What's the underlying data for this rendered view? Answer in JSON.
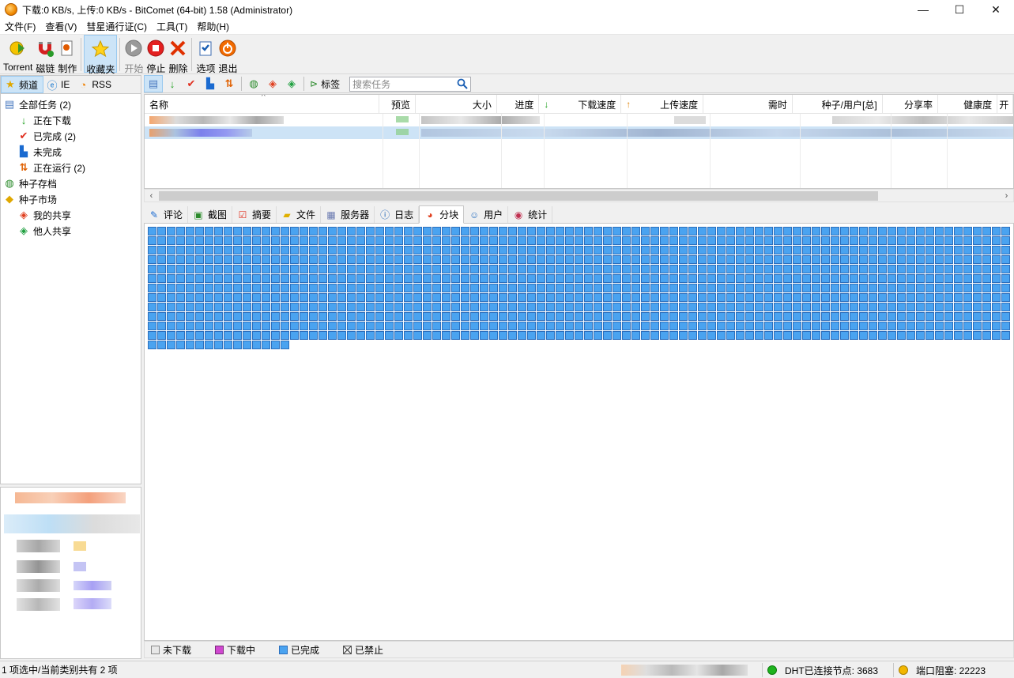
{
  "window": {
    "title": "下载:0 KB/s, 上传:0 KB/s - BitComet (64-bit) 1.58 (Administrator)",
    "minimize": "—",
    "maximize": "☐",
    "close": "✕"
  },
  "menu": [
    "文件(F)",
    "查看(V)",
    "彗星通行证(C)",
    "工具(T)",
    "帮助(H)"
  ],
  "toolbar": {
    "torrent": "Torrent",
    "magnet": "磁链",
    "make": "制作",
    "favorites": "收藏夹",
    "start": "开始",
    "stop": "停止",
    "delete": "删除",
    "options": "选项",
    "exit": "退出"
  },
  "left_tabs": {
    "channel": "频道",
    "ie": "IE",
    "rss": "RSS"
  },
  "tree": {
    "all": "全部任务 (2)",
    "downloading": "正在下载",
    "completed": "已完成 (2)",
    "incomplete": "未完成",
    "running": "正在运行 (2)",
    "archive": "种子存档",
    "market": "种子市场",
    "my_share": "我的共享",
    "others_share": "他人共享"
  },
  "task_toolbar": {
    "tag": "标签",
    "search_placeholder": "搜索任务"
  },
  "columns": {
    "name": "名称",
    "preview": "预览",
    "size": "大小",
    "progress": "进度",
    "down_speed": "下载速度",
    "up_speed": "上传速度",
    "eta": "需时",
    "seeds": "种子/用户[总]",
    "ratio": "分享率",
    "health": "健康度",
    "more": "开"
  },
  "detail_tabs": {
    "comment": "评论",
    "screenshot": "截图",
    "summary": "摘要",
    "files": "文件",
    "trackers": "服务器",
    "log": "日志",
    "pieces": "分块",
    "peers": "用户",
    "stats": "统计"
  },
  "pieces": {
    "total": 1107,
    "completed": 1107
  },
  "legend": {
    "not_downloaded": "未下载",
    "downloading": "下载中",
    "completed": "已完成",
    "disabled": "已禁止"
  },
  "status": {
    "selection": "1 项选中/当前类别共有 2 项",
    "dht": "DHT已连接节点: 3683",
    "port": "端口阻塞: 22223"
  },
  "colors": {
    "piece_completed": "#4aa3f0",
    "piece_downloading": "#d048d0",
    "piece_not_downloaded": "#e8e8e8",
    "dht_ok": "#1db31d",
    "port_warn": "#f2b600",
    "selection": "#cce4f7"
  }
}
